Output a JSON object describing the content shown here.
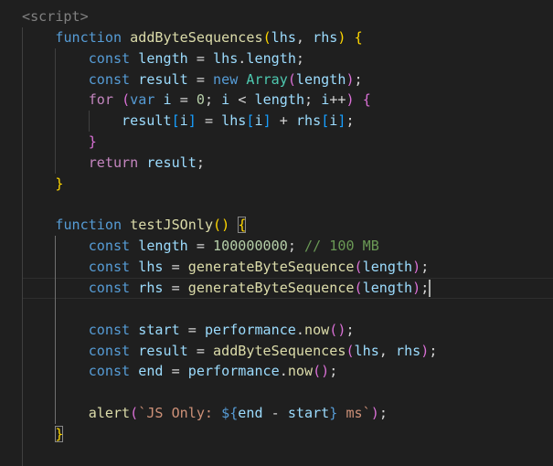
{
  "editor": {
    "lines": [
      [
        [
          "<script>",
          "tag"
        ]
      ],
      [
        [
          "    ",
          ""
        ],
        [
          "function",
          "kw"
        ],
        [
          " ",
          ""
        ],
        [
          "addByteSequences",
          "fn"
        ],
        [
          "(",
          "b1"
        ],
        [
          "lhs",
          "var"
        ],
        [
          ", ",
          ""
        ],
        [
          "rhs",
          "var"
        ],
        [
          ")",
          "b1"
        ],
        [
          " ",
          ""
        ],
        [
          "{",
          "b1"
        ]
      ],
      [
        [
          "        ",
          ""
        ],
        [
          "const",
          "kw"
        ],
        [
          " ",
          ""
        ],
        [
          "length",
          "var"
        ],
        [
          " = ",
          ""
        ],
        [
          "lhs",
          "var"
        ],
        [
          ".",
          ""
        ],
        [
          "length",
          "var"
        ],
        [
          ";",
          ""
        ]
      ],
      [
        [
          "        ",
          ""
        ],
        [
          "const",
          "kw"
        ],
        [
          " ",
          ""
        ],
        [
          "result",
          "var"
        ],
        [
          " = ",
          ""
        ],
        [
          "new",
          "kw"
        ],
        [
          " ",
          ""
        ],
        [
          "Array",
          "cls"
        ],
        [
          "(",
          "b2"
        ],
        [
          "length",
          "var"
        ],
        [
          ")",
          "b2"
        ],
        [
          ";",
          ""
        ]
      ],
      [
        [
          "        ",
          ""
        ],
        [
          "for",
          "ctl"
        ],
        [
          " ",
          ""
        ],
        [
          "(",
          "b2"
        ],
        [
          "var",
          "kw"
        ],
        [
          " ",
          ""
        ],
        [
          "i",
          "var"
        ],
        [
          " = ",
          ""
        ],
        [
          "0",
          "num"
        ],
        [
          "; ",
          ""
        ],
        [
          "i",
          "var"
        ],
        [
          " < ",
          ""
        ],
        [
          "length",
          "var"
        ],
        [
          "; ",
          ""
        ],
        [
          "i",
          "var"
        ],
        [
          "++",
          ""
        ],
        [
          ")",
          "b2"
        ],
        [
          " ",
          ""
        ],
        [
          "{",
          "b2"
        ]
      ],
      [
        [
          "            ",
          ""
        ],
        [
          "result",
          "var"
        ],
        [
          "[",
          "b3"
        ],
        [
          "i",
          "var"
        ],
        [
          "]",
          "b3"
        ],
        [
          " = ",
          ""
        ],
        [
          "lhs",
          "var"
        ],
        [
          "[",
          "b3"
        ],
        [
          "i",
          "var"
        ],
        [
          "]",
          "b3"
        ],
        [
          " + ",
          ""
        ],
        [
          "rhs",
          "var"
        ],
        [
          "[",
          "b3"
        ],
        [
          "i",
          "var"
        ],
        [
          "]",
          "b3"
        ],
        [
          ";",
          ""
        ]
      ],
      [
        [
          "        ",
          ""
        ],
        [
          "}",
          "b2"
        ]
      ],
      [
        [
          "        ",
          ""
        ],
        [
          "return",
          "ctl"
        ],
        [
          " ",
          ""
        ],
        [
          "result",
          "var"
        ],
        [
          ";",
          ""
        ]
      ],
      [
        [
          "    ",
          ""
        ],
        [
          "}",
          "b1"
        ]
      ],
      [],
      [
        [
          "    ",
          ""
        ],
        [
          "function",
          "kw"
        ],
        [
          " ",
          ""
        ],
        [
          "testJSOnly",
          "fn"
        ],
        [
          "()",
          "b1"
        ],
        [
          " ",
          ""
        ],
        [
          "{",
          "b1 match"
        ]
      ],
      [
        [
          "        ",
          ""
        ],
        [
          "const",
          "kw"
        ],
        [
          " ",
          ""
        ],
        [
          "length",
          "var"
        ],
        [
          " = ",
          ""
        ],
        [
          "100000000",
          "num"
        ],
        [
          "; ",
          ""
        ],
        [
          "// 100 MB",
          "cmt"
        ]
      ],
      [
        [
          "        ",
          ""
        ],
        [
          "const",
          "kw"
        ],
        [
          " ",
          ""
        ],
        [
          "lhs",
          "var"
        ],
        [
          " = ",
          ""
        ],
        [
          "generateByteSequence",
          "fn"
        ],
        [
          "(",
          "b2"
        ],
        [
          "length",
          "var"
        ],
        [
          ")",
          "b2"
        ],
        [
          ";",
          ""
        ]
      ],
      [
        [
          "        ",
          ""
        ],
        [
          "const",
          "kw"
        ],
        [
          " ",
          ""
        ],
        [
          "rhs",
          "var"
        ],
        [
          " = ",
          ""
        ],
        [
          "generateByteSequence",
          "fn"
        ],
        [
          "(",
          "b2"
        ],
        [
          "length",
          "var"
        ],
        [
          ")",
          "b2"
        ],
        [
          ";",
          ""
        ],
        [
          "",
          "cursor"
        ]
      ],
      [],
      [
        [
          "        ",
          ""
        ],
        [
          "const",
          "kw"
        ],
        [
          " ",
          ""
        ],
        [
          "start",
          "var"
        ],
        [
          " = ",
          ""
        ],
        [
          "performance",
          "var"
        ],
        [
          ".",
          ""
        ],
        [
          "now",
          "fn"
        ],
        [
          "()",
          "b2"
        ],
        [
          ";",
          ""
        ]
      ],
      [
        [
          "        ",
          ""
        ],
        [
          "const",
          "kw"
        ],
        [
          " ",
          ""
        ],
        [
          "result",
          "var"
        ],
        [
          " = ",
          ""
        ],
        [
          "addByteSequences",
          "fn"
        ],
        [
          "(",
          "b2"
        ],
        [
          "lhs",
          "var"
        ],
        [
          ", ",
          ""
        ],
        [
          "rhs",
          "var"
        ],
        [
          ")",
          "b2"
        ],
        [
          ";",
          ""
        ]
      ],
      [
        [
          "        ",
          ""
        ],
        [
          "const",
          "kw"
        ],
        [
          " ",
          ""
        ],
        [
          "end",
          "var"
        ],
        [
          " = ",
          ""
        ],
        [
          "performance",
          "var"
        ],
        [
          ".",
          ""
        ],
        [
          "now",
          "fn"
        ],
        [
          "()",
          "b2"
        ],
        [
          ";",
          ""
        ]
      ],
      [],
      [
        [
          "        ",
          ""
        ],
        [
          "alert",
          "fn"
        ],
        [
          "(",
          "b2"
        ],
        [
          "`JS Only: ",
          "str"
        ],
        [
          "${",
          "kw"
        ],
        [
          "end",
          "var"
        ],
        [
          " - ",
          ""
        ],
        [
          "start",
          "var"
        ],
        [
          "}",
          "kw"
        ],
        [
          " ms`",
          "str"
        ],
        [
          ")",
          "b2"
        ],
        [
          ";",
          ""
        ]
      ],
      [
        [
          "    ",
          ""
        ],
        [
          "}",
          "b1 match"
        ]
      ],
      []
    ],
    "active_line": 13
  }
}
